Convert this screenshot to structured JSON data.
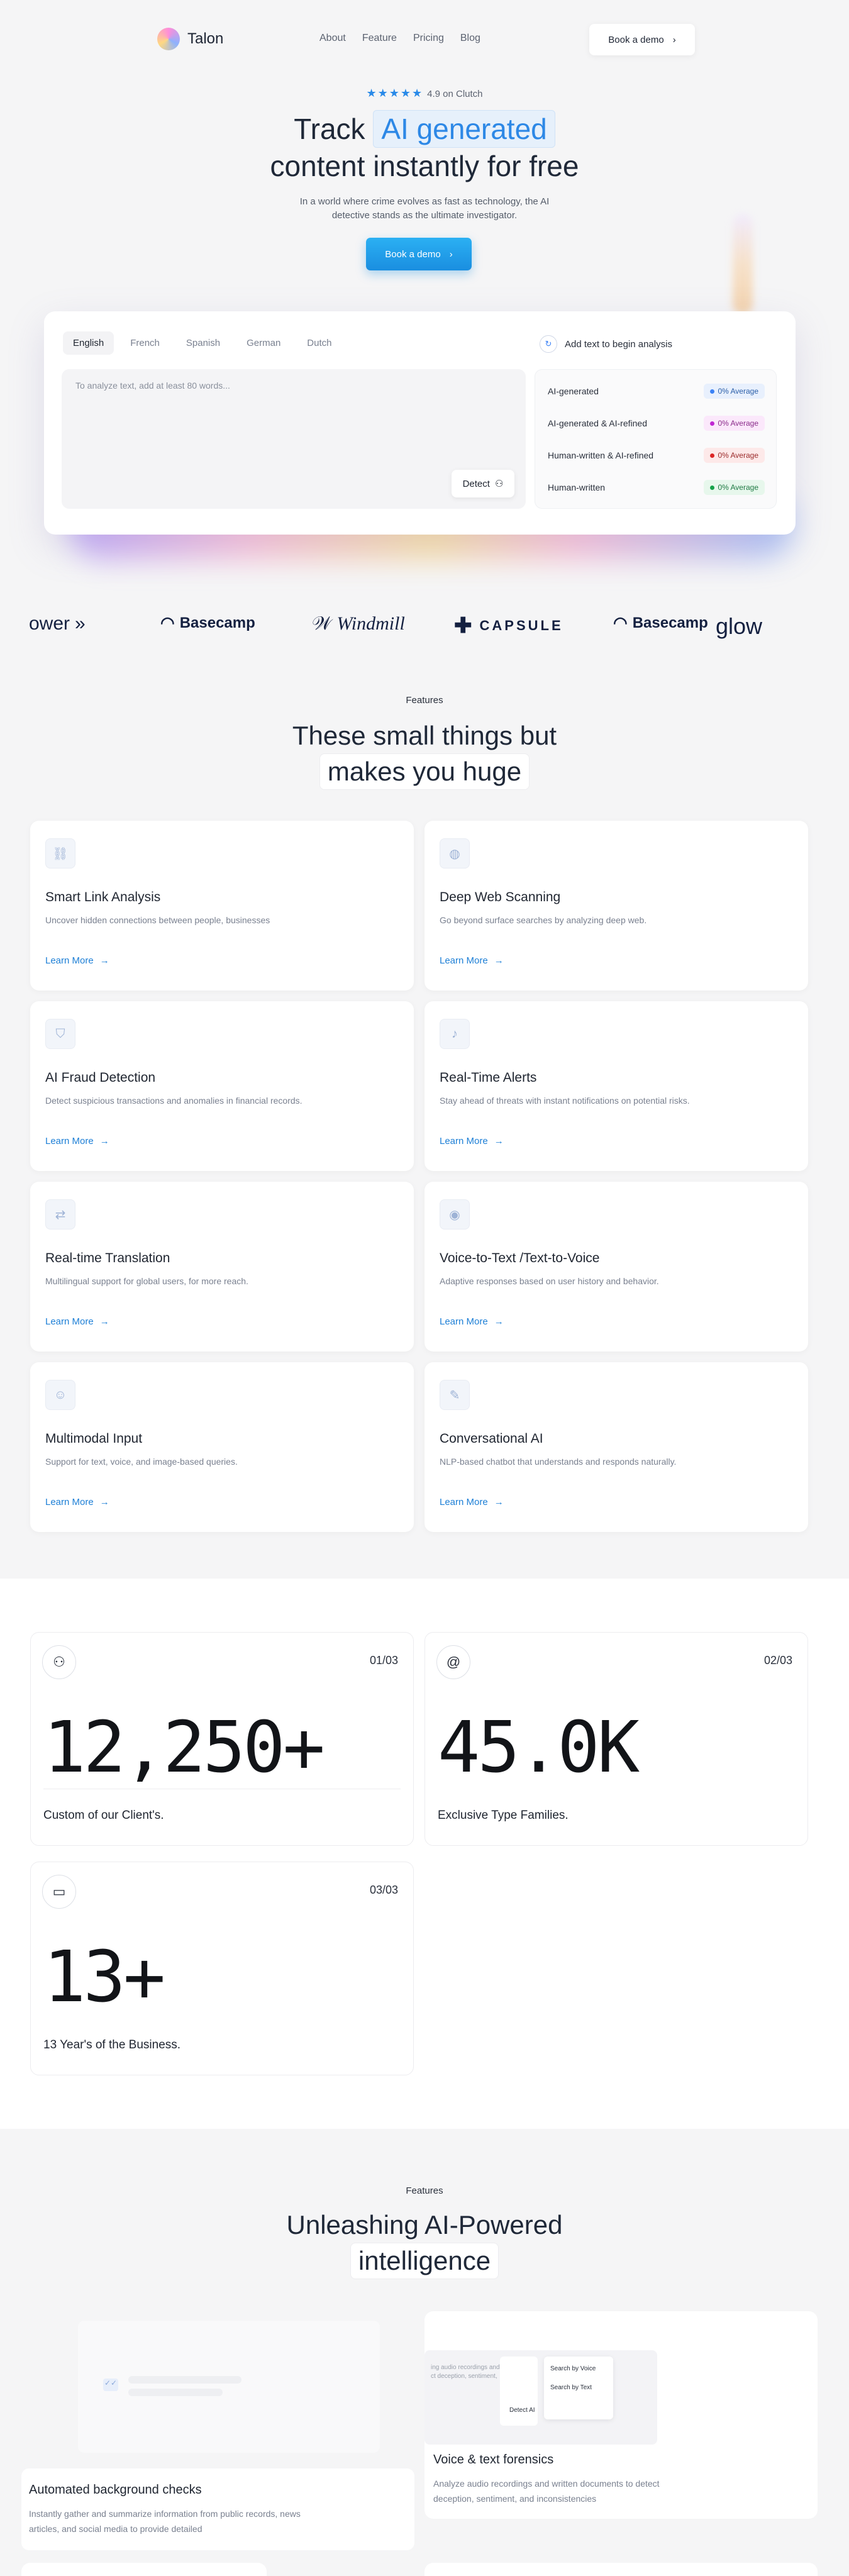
{
  "nav": {
    "brand": "Talon",
    "links": [
      "About",
      "Feature",
      "Pricing",
      "Blog"
    ],
    "cta": "Book a demo"
  },
  "hero": {
    "rating": "4.9 on Clutch",
    "title_a": "Track",
    "title_highlight": "AI generated",
    "title_b": "content instantly for free",
    "subtitle_1": "In a world where crime evolves as fast as technology, the AI",
    "subtitle_2": "detective stands as the ultimate investigator.",
    "cta": "Book a demo"
  },
  "analyzer": {
    "languages": [
      "English",
      "French",
      "Spanish",
      "German",
      "Dutch"
    ],
    "placeholder": "To analyze text, add at least 80 words...",
    "detect": "Detect",
    "add_text": "Add text to  begin analysis",
    "results": [
      {
        "label": "AI-generated",
        "badge": "0% Average",
        "color": "#3b82f6",
        "bg": "#e8f0fd"
      },
      {
        "label": "AI-generated & AI-refined",
        "badge": "0% Average",
        "color": "#c026d3",
        "bg": "#fbe8fb"
      },
      {
        "label": "Human-written & AI-refined",
        "badge": "0% Average",
        "color": "#dc2626",
        "bg": "#fde9e9"
      },
      {
        "label": "Human-written",
        "badge": "0% Average",
        "color": "#16a34a",
        "bg": "#e7f7ec"
      }
    ]
  },
  "logos": [
    "ower",
    "Basecamp",
    "Windmill",
    "CAPSULE",
    "Basecamp",
    "glow"
  ],
  "features": {
    "eyebrow": "Features",
    "title_1": "These small things but",
    "title_2": "makes you huge",
    "link": "Learn More",
    "items": [
      {
        "title": "Smart Link Analysis",
        "desc": "Uncover hidden connections between people, businesses",
        "icon": "link-icon"
      },
      {
        "title": "Deep Web Scanning",
        "desc": "Go beyond surface searches by analyzing deep web.",
        "icon": "globe-icon"
      },
      {
        "title": "AI Fraud Detection",
        "desc": "Detect suspicious transactions and anomalies in financial records.",
        "icon": "shield-icon"
      },
      {
        "title": "Real-Time Alerts",
        "desc": "Stay ahead of threats with instant notifications on potential risks.",
        "icon": "bell-icon"
      },
      {
        "title": "Real-time Translation",
        "desc": "Multilingual support for global users, for more reach.",
        "icon": "translate-icon"
      },
      {
        "title": "Voice-to-Text /Text-to-Voice",
        "desc": "Adaptive responses based on user history and behavior.",
        "icon": "voice-icon"
      },
      {
        "title": "Multimodal Input",
        "desc": "Support for text, voice, and image-based queries.",
        "icon": "user-icon"
      },
      {
        "title": "Conversational AI",
        "desc": "NLP-based chatbot that understands and responds naturally.",
        "icon": "chat-icon"
      }
    ]
  },
  "stats": [
    {
      "index": "01/03",
      "value": "12,250+",
      "label": "Custom of our Client's.",
      "icon": "users-icon"
    },
    {
      "index": "02/03",
      "value": "45.0K",
      "label": "Exclusive Type Families.",
      "icon": "at-icon"
    },
    {
      "index": "03/03",
      "value": "13+",
      "label": "13 Year's of the Business.",
      "icon": "window-icon"
    }
  ],
  "features2": {
    "eyebrow": "Features",
    "title_1": "Unleashing AI-Powered",
    "title_2": "intelligence",
    "cards": [
      {
        "title": "Automated background checks",
        "desc_1": "Instantly gather and summarize information from public records, news",
        "desc_2": "articles, and social media to provide detailed"
      },
      {
        "title": "Voice & text forensics",
        "desc_1": "Analyze audio recordings and written documents to detect",
        "desc_2": "deception, sentiment, and inconsistencies",
        "mock_1": "Search by Voice",
        "mock_2": "Search by Text",
        "mock_3": "Detect AI"
      }
    ]
  },
  "colors": {
    "accent": "#1d8fe2",
    "highlight": "#2d88e6"
  }
}
